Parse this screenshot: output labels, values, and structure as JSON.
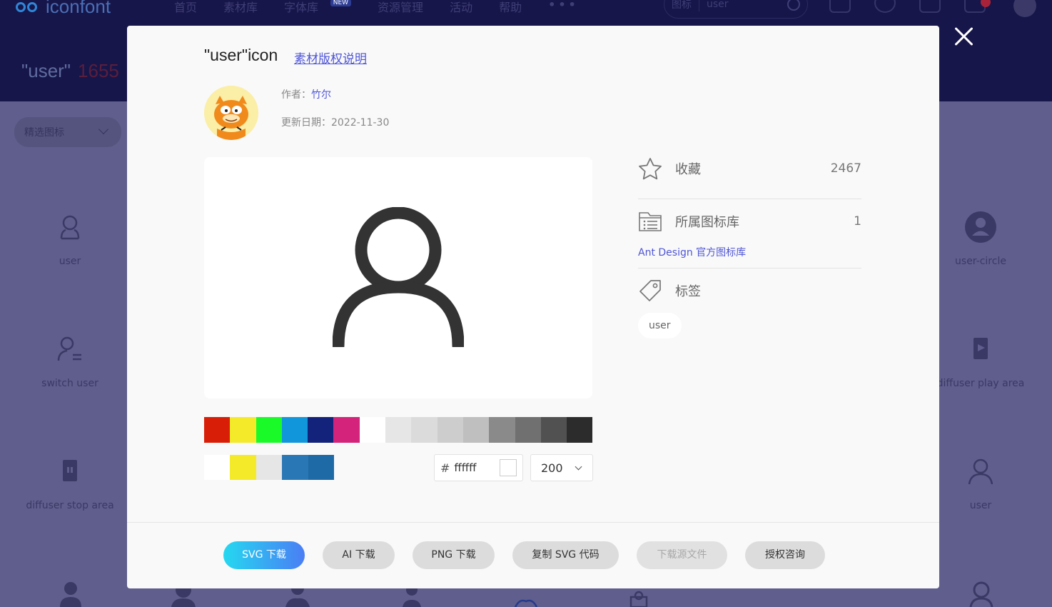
{
  "bg": {
    "logo_text": "iconfont",
    "nav": [
      "首页",
      "素材库",
      "字体库",
      "资源管理",
      "活动",
      "帮助"
    ],
    "nav_more": "•••",
    "new_badge": "NEW",
    "search_type": "图标",
    "search_value": "user",
    "page_title": "\"user\"",
    "page_count": "1655",
    "filter_label": "精选图标",
    "grid_labels": {
      "left": [
        "user",
        "switch user",
        "diffuser stop area"
      ],
      "right": [
        "user-circle",
        "diffuser play area",
        "user"
      ]
    }
  },
  "modal": {
    "title": "\"user\"icon",
    "copyright_link": "素材版权说明",
    "author_label": "作者：",
    "author_name": "竹尔",
    "date_label": "更新日期：",
    "date_value": "2022-11-30",
    "preview_icon": "user-icon",
    "preview_color": "#333333",
    "palette": [
      "#d81e06",
      "#f4ea2a",
      "#1afa29",
      "#1296db",
      "#13227a",
      "#d4237a",
      "#ffffff",
      "#e6e6e6",
      "#dbdbdb",
      "#cdcdcd",
      "#bfbfbf",
      "#8a8a8a",
      "#707070",
      "#515151",
      "#2c2c2c"
    ],
    "recent_colors": [
      "#ffffff",
      "#f4ea2a",
      "#e6e6e6",
      "#2a77b5",
      "#1e6aa6"
    ],
    "hex_hash": "#",
    "hex_value": "ffffff",
    "size_value": "200",
    "favorites_label": "收藏",
    "favorites_count": "2467",
    "library_label": "所属图标库",
    "library_count": "1",
    "library_link": "Ant Design 官方图标库",
    "tags_label": "标签",
    "tags": [
      "user"
    ],
    "buttons": {
      "svg": "SVG 下载",
      "ai": "AI 下载",
      "png": "PNG 下载",
      "copy_svg": "复制 SVG 代码",
      "source": "下载源文件",
      "license": "授权咨询"
    }
  }
}
